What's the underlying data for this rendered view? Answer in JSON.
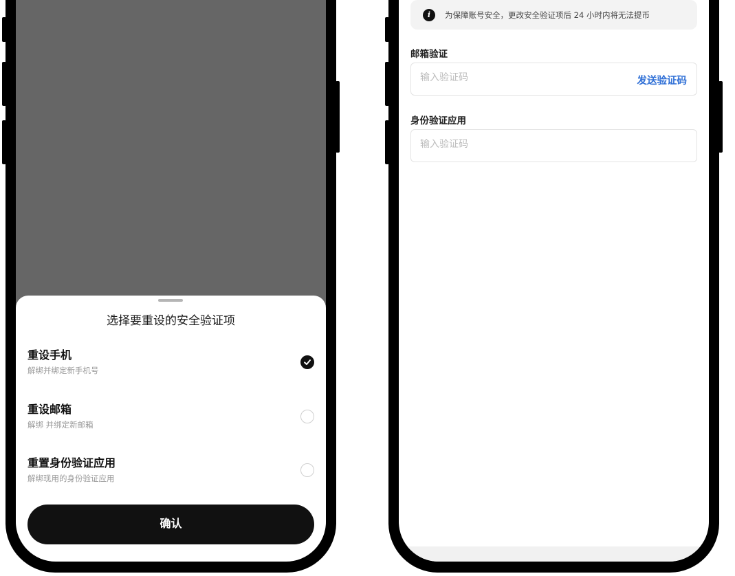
{
  "left": {
    "sheet_title": "选择要重设的安全验证项",
    "options": [
      {
        "title": "重设手机",
        "desc": "解绑并绑定新手机号",
        "selected": true
      },
      {
        "title": "重设邮箱",
        "desc": "解绑  并绑定新邮箱",
        "selected": false
      },
      {
        "title": "重置身份验证应用",
        "desc": "解绑现用的身份验证应用",
        "selected": false
      }
    ],
    "confirm_label": "确认"
  },
  "right": {
    "notice_icon": "i",
    "notice_text": "为保障账号安全，更改安全验证项后 24 小时内将无法提币",
    "email": {
      "label": "邮箱验证",
      "placeholder": "输入验证码",
      "value": "",
      "send_label": "发送验证码"
    },
    "auth_app": {
      "label": "身份验证应用",
      "placeholder": "输入验证码",
      "value": ""
    }
  },
  "colors": {
    "accent_link": "#2f6fd6",
    "overlay": "#666666",
    "primary_button": "#111111"
  }
}
